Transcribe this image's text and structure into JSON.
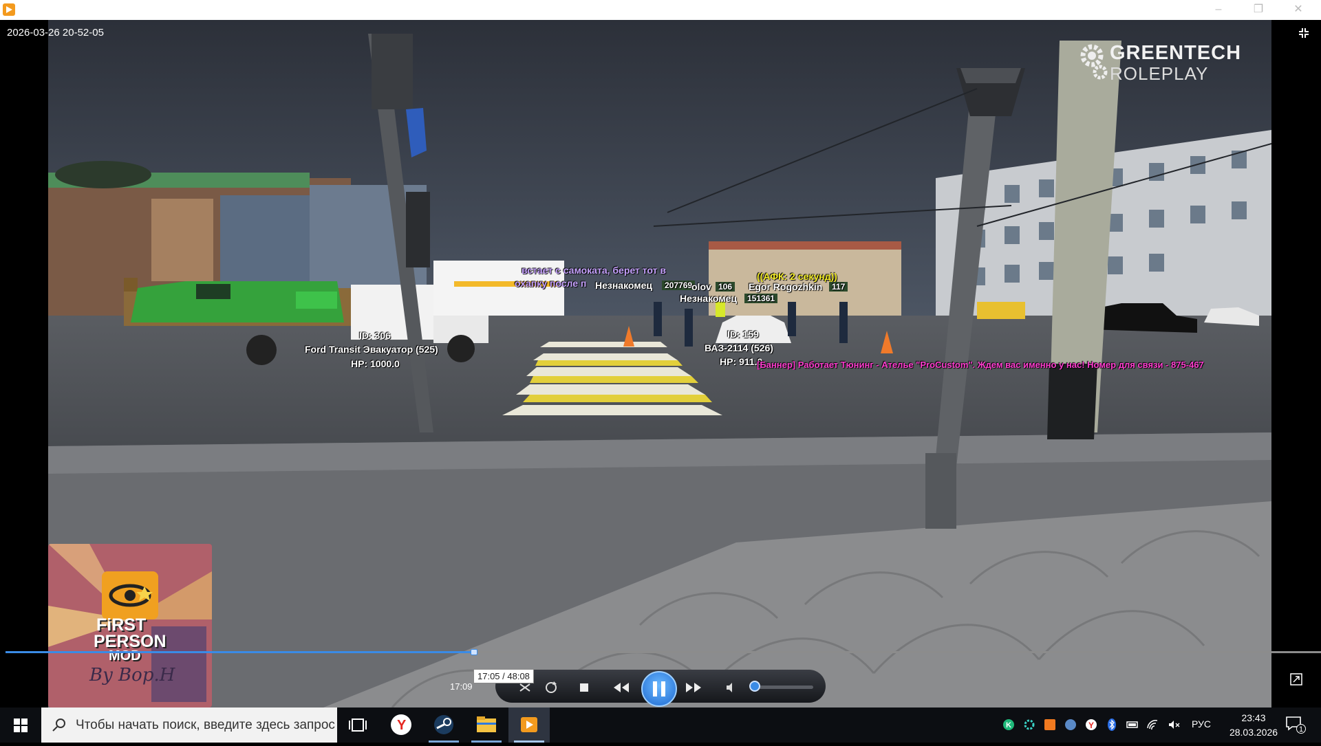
{
  "window": {
    "minimize_icon": "minimize-icon",
    "restore_icon": "restore-icon",
    "close_icon": "close-icon"
  },
  "player": {
    "timestamp_overlay": "2026-03-26 20-52-05",
    "current_time": "17:09",
    "tooltip": "17:05 / 48:08",
    "progress": 0.356,
    "volume": 0.05
  },
  "video_overlay": {
    "server_logo_line1": "GREENTECH",
    "server_logo_line2": "ROLEPLAY",
    "labels": {
      "chat_line1": "встает с самоката, берет тот в",
      "chat_line2": "охапку после п",
      "stranger1": "Незнакомец",
      "stranger1_id": "207769",
      "partial_name": "olov",
      "partial_id": "106",
      "afk": "((АФК: 2 секунд))",
      "egor": "Egor Rogozhkin",
      "egor_id": "117",
      "stranger2": "Незнакомец",
      "stranger2_id": "151361",
      "tow_id": "ID: 306",
      "tow_name": "Ford Transit Эвакуатор (525)",
      "tow_hp": "HP: 1000.0",
      "car_id": "ID: 159",
      "car_name": "ВАЗ-2114 (526)",
      "car_hp": "HP: 911.0",
      "banner": "[Баннер] Работает Тюнинг - Ателье \"ProCustom\". Ждем вас именно у нас! Номер для связи - 875-467"
    },
    "corner_badge": {
      "line1": "FiRST",
      "line2": "PERSON",
      "line3": "MOD",
      "signature": "By Bop.H"
    }
  },
  "taskbar": {
    "search_placeholder": "Чтобы начать поиск, введите здесь запрос",
    "language": "РУС",
    "time": "23:43",
    "date": "28.03.2026",
    "notification_count": "1",
    "colors": {
      "accent": "#3a8be6",
      "taskbar": "#0c0e12"
    }
  }
}
